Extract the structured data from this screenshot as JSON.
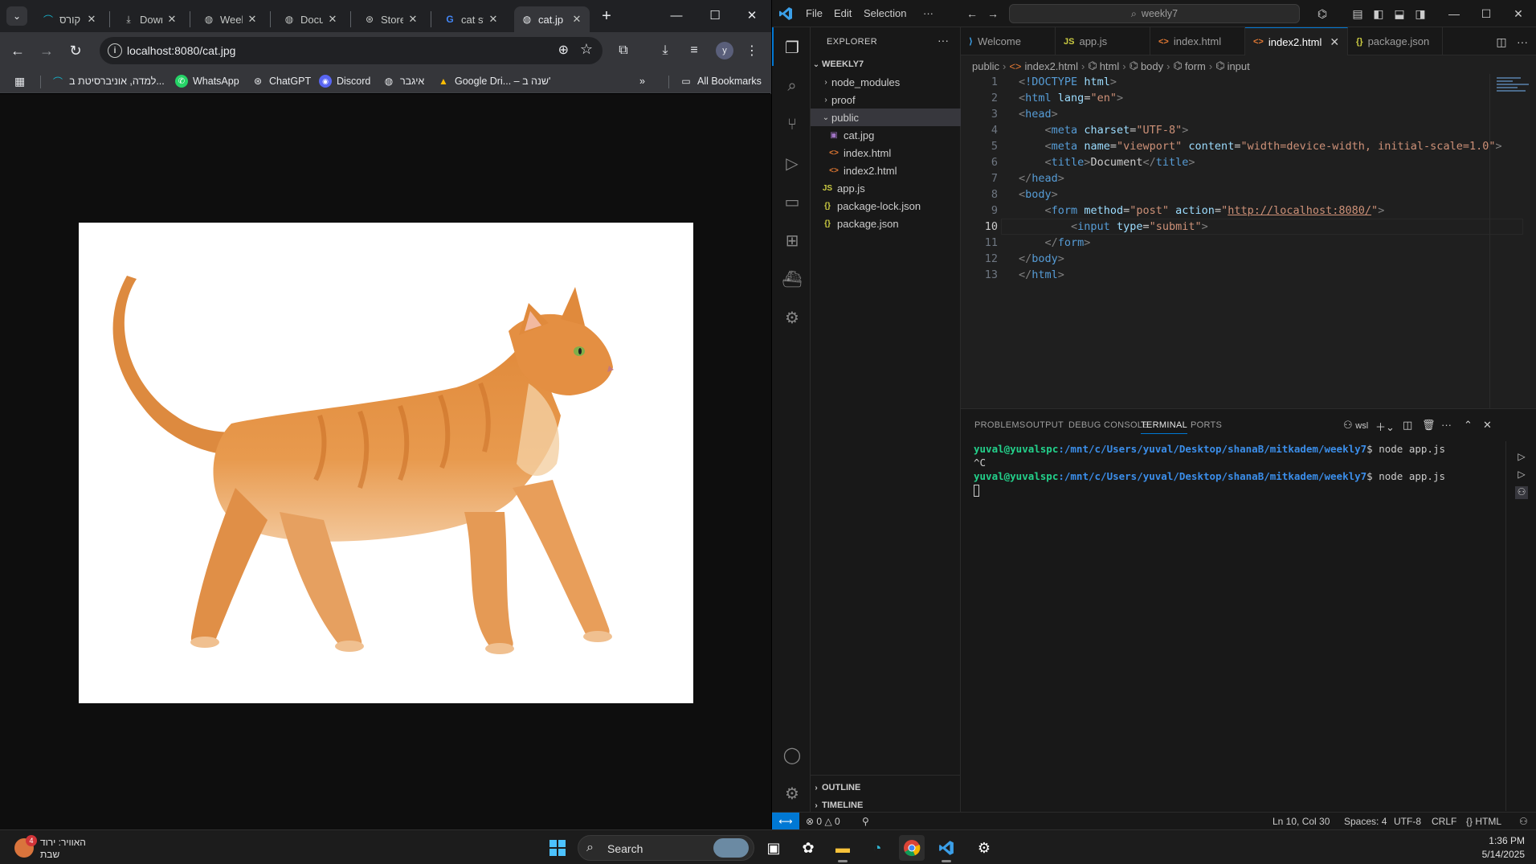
{
  "chrome": {
    "tabs": [
      {
        "title": "קורס",
        "icon": "brand-icon"
      },
      {
        "title": "Down",
        "icon": "download-icon"
      },
      {
        "title": "Week",
        "icon": "globe-icon"
      },
      {
        "title": "Docu",
        "icon": "globe-icon"
      },
      {
        "title": "Store",
        "icon": "openai-icon"
      },
      {
        "title": "cat st",
        "icon": "google-icon"
      },
      {
        "title": "cat.jp",
        "icon": "globe-icon"
      }
    ],
    "url": "localhost:8080/cat.jpg",
    "profile_initial": "y",
    "bookmarks": [
      {
        "label": "למדה, אוניברסיטת ב...",
        "icon": "brand-icon"
      },
      {
        "label": "WhatsApp",
        "icon": "whatsapp-icon"
      },
      {
        "label": "ChatGPT",
        "icon": "openai-icon"
      },
      {
        "label": "Discord",
        "icon": "discord-icon"
      },
      {
        "label": "איגבר",
        "icon": "globe-icon"
      },
      {
        "label": "Google Dri... – שנה ב'",
        "icon": "google-drive-icon"
      }
    ],
    "all_bookmarks": "All Bookmarks",
    "image_alt": "orange tabby cat walking"
  },
  "vscode": {
    "menu": [
      "File",
      "Edit",
      "Selection",
      "···"
    ],
    "search": "weekly7",
    "explorer": {
      "header": "EXPLORER",
      "root": "WEEKLY7",
      "items": [
        {
          "label": "node_modules",
          "kind": "folder"
        },
        {
          "label": "proof",
          "kind": "folder"
        },
        {
          "label": "public",
          "kind": "folder-open"
        },
        {
          "label": "cat.jpg",
          "kind": "image"
        },
        {
          "label": "index.html",
          "kind": "html"
        },
        {
          "label": "index2.html",
          "kind": "html"
        },
        {
          "label": "app.js",
          "kind": "js"
        },
        {
          "label": "package-lock.json",
          "kind": "json"
        },
        {
          "label": "package.json",
          "kind": "json"
        }
      ],
      "outline": "OUTLINE",
      "timeline": "TIMELINE"
    },
    "tabs": [
      {
        "label": "Welcome",
        "icon": "vscode-icon"
      },
      {
        "label": "app.js",
        "icon": "js-icon"
      },
      {
        "label": "index.html",
        "icon": "html-icon"
      },
      {
        "label": "index2.html",
        "icon": "html-icon"
      },
      {
        "label": "package.json",
        "icon": "json-icon"
      }
    ],
    "breadcrumbs": [
      "public",
      "index2.html",
      "html",
      "body",
      "form",
      "input"
    ],
    "code_lines": [
      "<!DOCTYPE html>",
      "<html lang=\"en\">",
      "<head>",
      "    <meta charset=\"UTF-8\">",
      "    <meta name=\"viewport\" content=\"width=device-width, initial-scale=1.0\">",
      "    <title>Document</title>",
      "</head>",
      "<body>",
      "    <form method=\"post\" action=\"http://localhost:8080/\">",
      "        <input type=\"submit\">",
      "    </form>",
      "</body>",
      "</html>"
    ],
    "current_line": 10,
    "panel_tabs": [
      "PROBLEMS",
      "OUTPUT",
      "DEBUG CONSOLE",
      "TERMINAL",
      "PORTS"
    ],
    "terminal_shell": "wsl",
    "terminal": {
      "user": "yuval@yuvalspc",
      "path": ":/mnt/c/Users/yuval/Desktop/shanaB/mitkadem/weekly7",
      "cmd": "$ node app.js",
      "interrupt": "^C"
    },
    "status": {
      "errors": "0",
      "warnings": "0",
      "position": "Ln 10, Col 30",
      "spaces": "Spaces: 4",
      "encoding": "UTF-8",
      "eol": "CRLF",
      "language": "HTML"
    }
  },
  "taskbar": {
    "weather_line1": "האוויר: ירוד",
    "weather_line2": "שבת",
    "weather_badge": "4",
    "search": "Search",
    "time": "1:36 PM",
    "date": "5/14/2025"
  }
}
